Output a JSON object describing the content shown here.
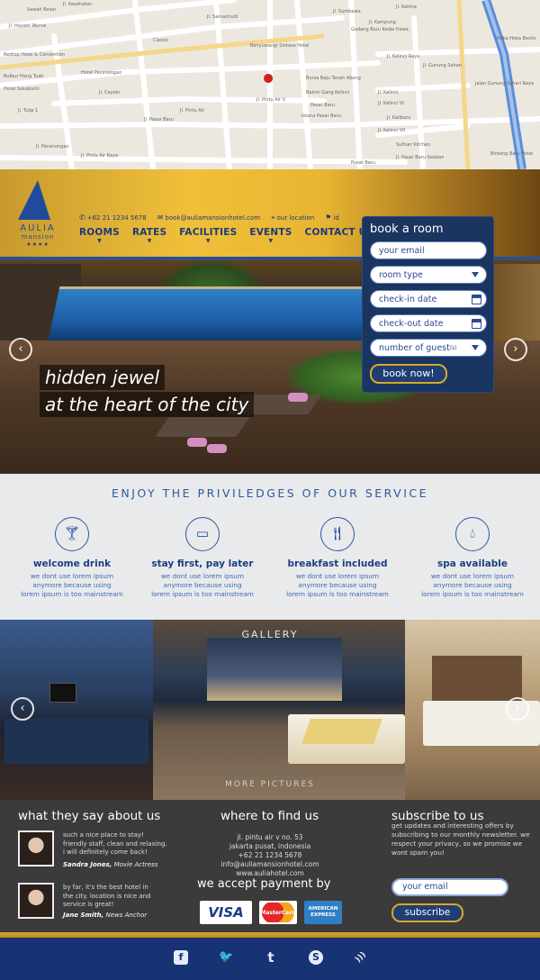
{
  "map": {
    "labels": [
      "Sawah Besar",
      "Jl. Kesehatan",
      "Jl. Hayam Wuruk",
      "Classic",
      "Jl. Samanhudi",
      "Banyuwangi Sintesa Hotel",
      "Jl. Sumbawa",
      "Jl. Kampung",
      "Jl. Kelima",
      "Redtop Hotel & Convention",
      "Bulbur Hang Tuah",
      "Hotel Pecenongan",
      "Hotel Sukabumi",
      "Jl. Ceylon",
      "Jl. Pintu Air V",
      "Jl. Pintu Air",
      "Jl. Tulip 1",
      "Jl. Pecenongan",
      "Jl. Pasar Baru",
      "Bursa Baju Tanah Abang",
      "Bakmi Gang Kelinci",
      "Pasar Baru",
      "Istana Pasar Baru",
      "Jl. Pintu Air Raya",
      "Jl. Gunung Sahari",
      "Jl. Kelinci",
      "Jl. Kalibaru",
      "Hoka Hoka Bento",
      "Bintang Baru Hotel",
      "Jl. Pasar Baru Selatan",
      "Jl. Kelinci VI",
      "Jl. Kelinci VII",
      "Jalan Gunung Sahari Raya",
      "Sulfuer Kitchen",
      "Pusat Baru",
      "Gudang Baru Kedai Hawa",
      "Jl. Kelinci Raya"
    ]
  },
  "header": {
    "brand": "AULIA",
    "brand_sub": "mansion",
    "stars": "★★★★",
    "phone": "+62 21 1234 5678",
    "email": "book@auliamansionhotel.com",
    "location": "our location",
    "lang": "id"
  },
  "nav": [
    {
      "label": "ROOMS"
    },
    {
      "label": "RATES"
    },
    {
      "label": "FACILITIES"
    },
    {
      "label": "EVENTS"
    },
    {
      "label": "CONTACT US"
    }
  ],
  "booking": {
    "title": "book a room",
    "email_placeholder": "your email",
    "room_type": "room type",
    "checkin": "check-in date",
    "checkout": "check-out date",
    "guests": "number of guest",
    "guests_suffix": "(s)",
    "submit": "book now!"
  },
  "hero": {
    "line1": "hidden jewel",
    "line2": "at the heart of the city"
  },
  "services": {
    "heading": "ENJOY THE PRIVILEDGES OF OUR SERVICE",
    "items": [
      {
        "title": "welcome drink",
        "d1": "we dont use lorem ipsum",
        "d2": "anymore because using",
        "d3": "lorem ipsum is too mainstream",
        "icon": "cocktail-icon"
      },
      {
        "title": "stay first, pay later",
        "d1": "we dont use lorem ipsum",
        "d2": "anymore because using",
        "d3": "lorem ipsum is too mainstream",
        "icon": "card-icon"
      },
      {
        "title": "breakfast included",
        "d1": "we dont use lorem ipsum",
        "d2": "anymore because using",
        "d3": "lorem ipsum is too mainstream",
        "icon": "fork-knife-icon"
      },
      {
        "title": "spa available",
        "d1": "we dont use lorem ipsum",
        "d2": "anymore because using",
        "d3": "lorem ipsum is too mainstream",
        "icon": "drop-icon"
      }
    ]
  },
  "gallery": {
    "title": "GALLERY",
    "more": "MORE PICTURES"
  },
  "testimonials": {
    "title": "what they say about us",
    "items": [
      {
        "l1": "such a nice place to stay!",
        "l2": "friendly staff, clean and relaxing.",
        "l3": "i will definitely come back!",
        "name": "Sandra Jones,",
        "role": "Movie Actress"
      },
      {
        "l1": "by far, it's the best hotel in",
        "l2": "the city. location is nice and",
        "l3": "service is great!",
        "name": "Jane Smith,",
        "role": "News Anchor"
      }
    ]
  },
  "findus": {
    "title": "where to find us",
    "lines": [
      "jl. pintu air v no. 53",
      "jakarta pusat, indonesia",
      "+62 21 1234 5678",
      "info@auliamansionhotel.com",
      "www.auliahotel.com"
    ]
  },
  "payment": {
    "title": "we accept payment by",
    "visa": "VISA",
    "mastercard": "MasterCard",
    "amex1": "AMERICAN",
    "amex2": "EXPRESS"
  },
  "subscribe": {
    "title": "subscribe to us",
    "text": "get updates and interesting offers by subscribing to our monthly newsletter. we respect your privacy, so we promise we wont spam you!",
    "placeholder": "your email",
    "button": "subscribe"
  },
  "social": {
    "facebook": "f",
    "twitter": "🐦",
    "tumblr": "t",
    "skype": "S",
    "rss": ")))"
  },
  "colors": {
    "brand_blue": "#1c3a7a",
    "gold": "#d9a92b",
    "footer_bg": "#3b3b3b",
    "social_bar": "#183374"
  }
}
